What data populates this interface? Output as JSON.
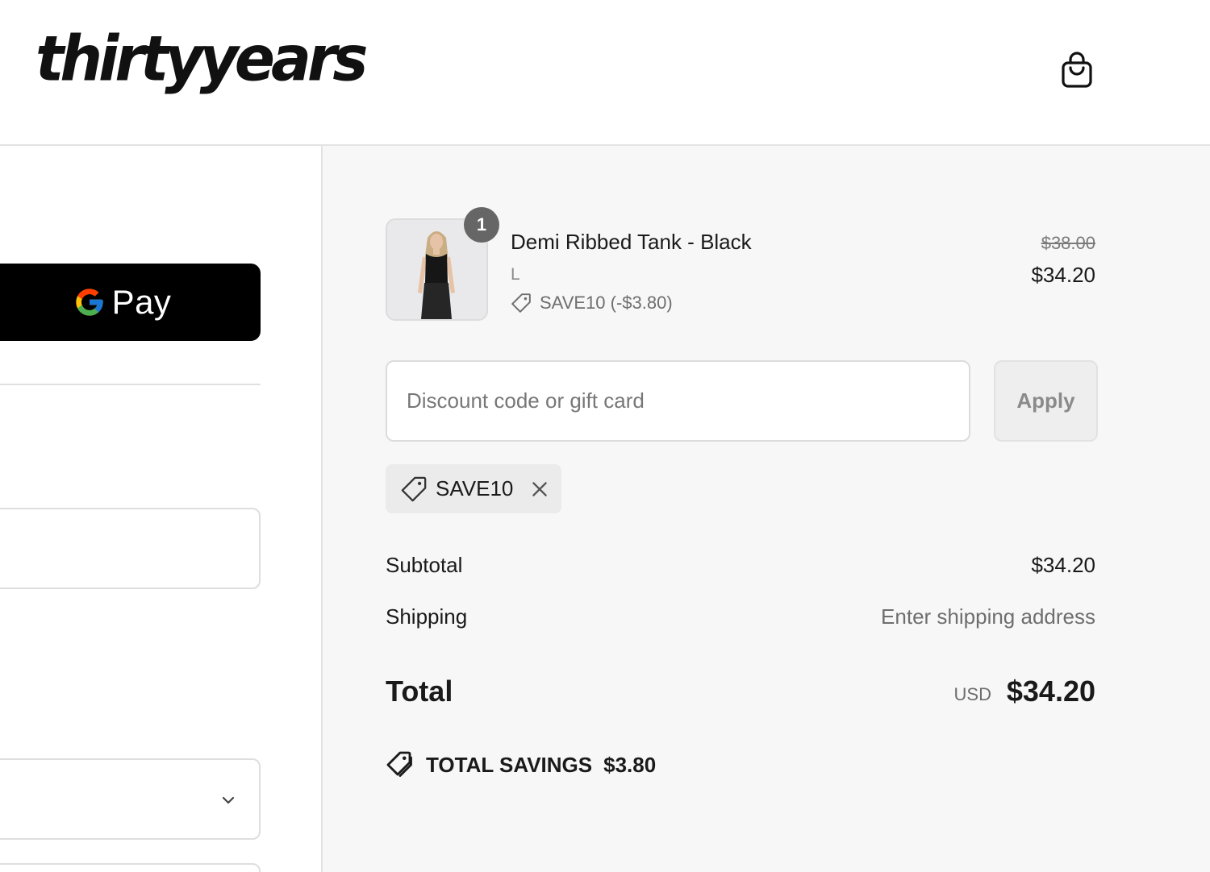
{
  "header": {
    "logo_text": "thirtyyears",
    "cart_icon": "shopping-bag-icon"
  },
  "express": {
    "gpay_label": "Pay"
  },
  "order": {
    "item": {
      "name": "Demi Ribbed Tank - Black",
      "variant": "L",
      "quantity": "1",
      "discount_line": "SAVE10 (-$3.80)",
      "price_original": "$38.00",
      "price_final": "$34.20"
    },
    "discount": {
      "placeholder": "Discount code or gift card",
      "apply_label": "Apply",
      "applied_code": "SAVE10"
    },
    "summary": {
      "subtotal_label": "Subtotal",
      "subtotal_value": "$34.20",
      "shipping_label": "Shipping",
      "shipping_value": "Enter shipping address",
      "total_label": "Total",
      "total_currency": "USD",
      "total_value": "$34.20",
      "savings_label": "TOTAL SAVINGS",
      "savings_value": "$3.80"
    }
  },
  "colors": {
    "summary_bg": "#f7f7f7",
    "gpay_bg": "#000000",
    "badge_bg": "#666666"
  }
}
